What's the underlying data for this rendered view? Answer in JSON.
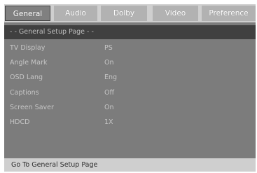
{
  "tabs": [
    {
      "label": "General"
    },
    {
      "label": "Audio"
    },
    {
      "label": "Dolby"
    },
    {
      "label": "Video"
    },
    {
      "label": "Preference"
    }
  ],
  "page_header": "- - General Setup Page - -",
  "settings": [
    {
      "label": "TV Display",
      "value": "PS"
    },
    {
      "label": "Angle Mark",
      "value": "On"
    },
    {
      "label": "OSD Lang",
      "value": "Eng"
    },
    {
      "label": "Captions",
      "value": "Off"
    },
    {
      "label": "Screen Saver",
      "value": "On"
    },
    {
      "label": "HDCD",
      "value": "1X"
    }
  ],
  "status_text": "Go To General Setup Page",
  "colors": {
    "menu_bg": "#7c7c7c",
    "tab_bar_bg": "#cfcfcf",
    "active_tab_bg": "#808080",
    "header_bg": "#404040",
    "footer_bg": "#cfcfcf"
  }
}
